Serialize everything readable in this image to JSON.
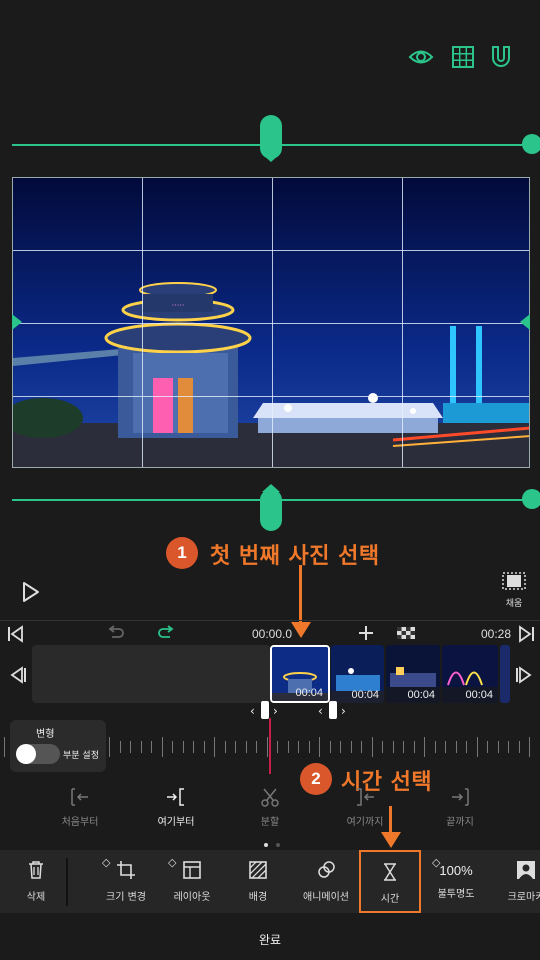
{
  "header": {
    "icons": [
      "eye-icon",
      "grid-icon",
      "magnet-icon"
    ],
    "accent_color": "#2bc48a"
  },
  "preview": {
    "fill_label": "채움"
  },
  "annotations": {
    "step1_number": "1",
    "step1_text": "첫 번째 사진 선택",
    "step2_number": "2",
    "step2_text": "시간 선택",
    "color": "#f0782a"
  },
  "timeline": {
    "current_time": "00:00.0",
    "total_time": "00:28",
    "clips": [
      {
        "duration": "00:04"
      },
      {
        "duration": "00:04"
      },
      {
        "duration": "00:04"
      },
      {
        "duration": "00:04"
      }
    ]
  },
  "transform": {
    "title": "변형",
    "toggle_label": "부분 설정",
    "toggle_on": false
  },
  "edit_tools": [
    {
      "label": "처음부터"
    },
    {
      "label": "여기부터"
    },
    {
      "label": "분할"
    },
    {
      "label": "여기까지"
    },
    {
      "label": "끝까지"
    }
  ],
  "toolbar": {
    "delete": "삭제",
    "resize": "크기 변경",
    "layout": "레이아웃",
    "background": "배경",
    "animation": "애니메이션",
    "time": "시간",
    "opacity_value": "100%",
    "opacity": "불투명도",
    "chroma": "크로마키"
  },
  "done_label": "완료"
}
